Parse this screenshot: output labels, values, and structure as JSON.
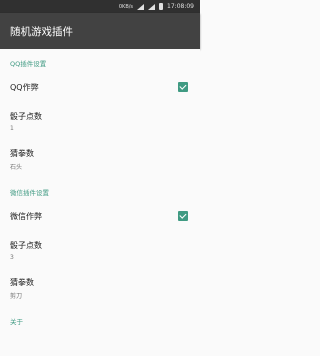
{
  "status_bar": {
    "net_speed": "0KB/s",
    "time": "17:08:09"
  },
  "app_bar": {
    "title": "随机游戏插件"
  },
  "qq_section": {
    "header": "QQ插件设置",
    "cheat": {
      "title": "QQ作弊",
      "checked": true
    },
    "dice": {
      "title": "骰子点数",
      "summary": "1"
    },
    "rps": {
      "title": "猜拳数",
      "summary": "石头"
    }
  },
  "wechat_section": {
    "header": "微信插件设置",
    "cheat": {
      "title": "微信作弊",
      "checked": true
    },
    "dice": {
      "title": "骰子点数",
      "summary": "3"
    },
    "rps": {
      "title": "猜拳数",
      "summary": "剪刀"
    }
  },
  "about_section": {
    "header": "关于"
  },
  "colors": {
    "accent": "#3f9a82",
    "app_bar": "#424242",
    "status_bar": "#303030"
  }
}
